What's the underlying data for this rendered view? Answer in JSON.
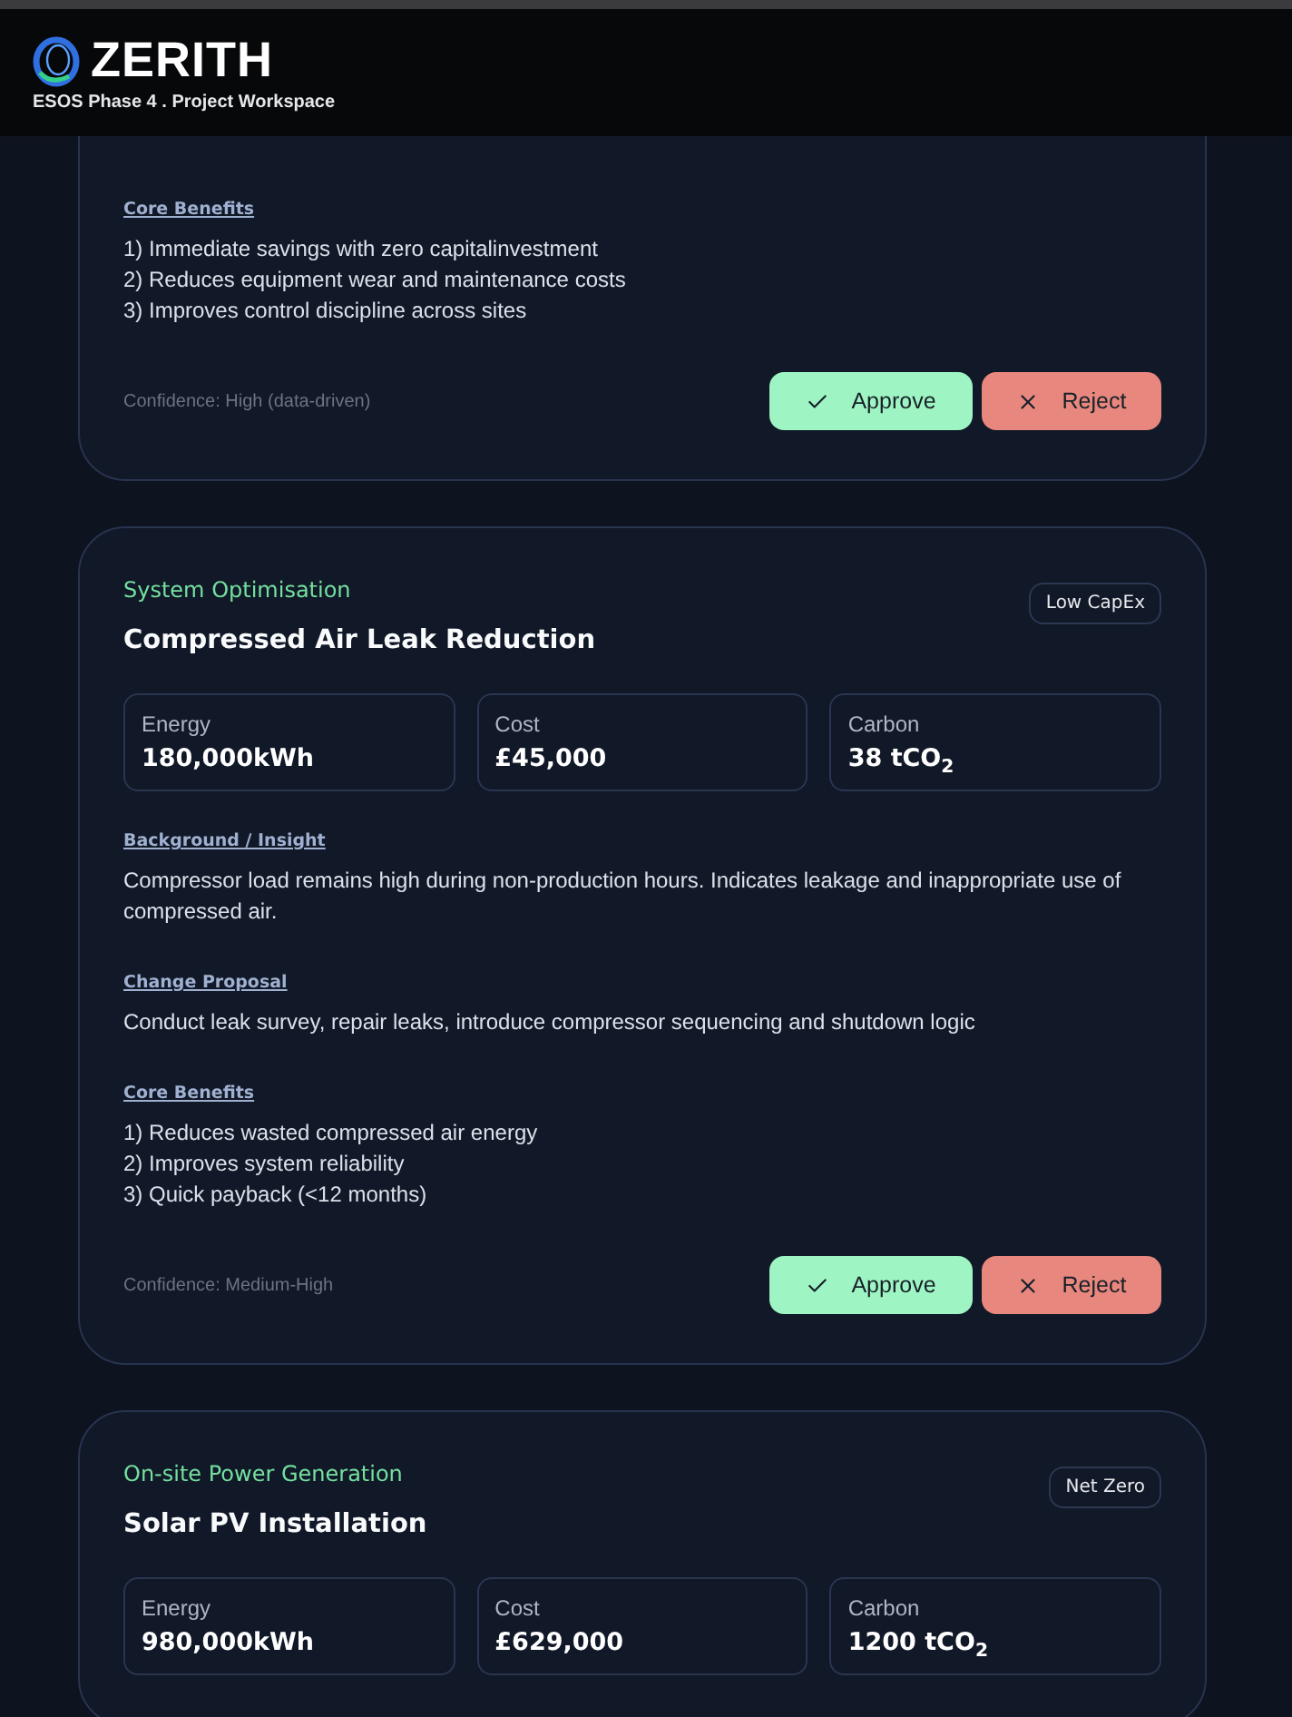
{
  "header": {
    "brand": "ZERITH",
    "subtitle": "ESOS Phase 4 . Project Workspace"
  },
  "cards": [
    {
      "sections": [
        {
          "kind": "section",
          "label": "Core Benefits",
          "lines": [
            "1) Immediate savings with zero capitalinvestment",
            "2) Reduces equipment wear and maintenance costs",
            "3) Improves control discipline across sites"
          ]
        }
      ],
      "confidence": "Confidence: High (data-driven)",
      "actions": [
        {
          "kind": "approve",
          "label": "Approve"
        },
        {
          "kind": "reject",
          "label": "Reject"
        }
      ]
    },
    {
      "category": "System Optimisation",
      "title": "Compressed Air Leak Reduction",
      "badge": "Low CapEx",
      "metrics": [
        {
          "label": "Energy",
          "value": "180,000kWh"
        },
        {
          "label": "Cost",
          "value": "£45,000"
        },
        {
          "label": "Carbon",
          "value": "38 tCO$_{2}$"
        }
      ],
      "sections": [
        {
          "kind": "section",
          "label": "Background / Insight",
          "lines": [
            "Compressor load remains high during non-production hours. Indicates leakage and inappropriate use of compressed air."
          ]
        },
        {
          "kind": "section",
          "label": "Change Proposal",
          "lines": [
            "Conduct leak survey, repair leaks, introduce compressor sequencing and shutdown logic"
          ]
        },
        {
          "kind": "section",
          "label": "Core Benefits",
          "lines": [
            "1) Reduces wasted compressed air energy",
            "2) Improves system reliability",
            "3) Quick payback (<12 months)"
          ]
        }
      ],
      "confidence": "Confidence: Medium-High",
      "actions": [
        {
          "kind": "approve",
          "label": "Approve"
        },
        {
          "kind": "reject",
          "label": "Reject"
        }
      ]
    },
    {
      "category": "On-site Power Generation",
      "title": "Solar PV Installation",
      "badge": "Net Zero",
      "metrics": [
        {
          "label": "Energy",
          "value": "980,000kWh"
        },
        {
          "label": "Cost",
          "value": "£629,000"
        },
        {
          "label": "Carbon",
          "value": "1200 tCO$_{2}$"
        }
      ]
    }
  ]
}
